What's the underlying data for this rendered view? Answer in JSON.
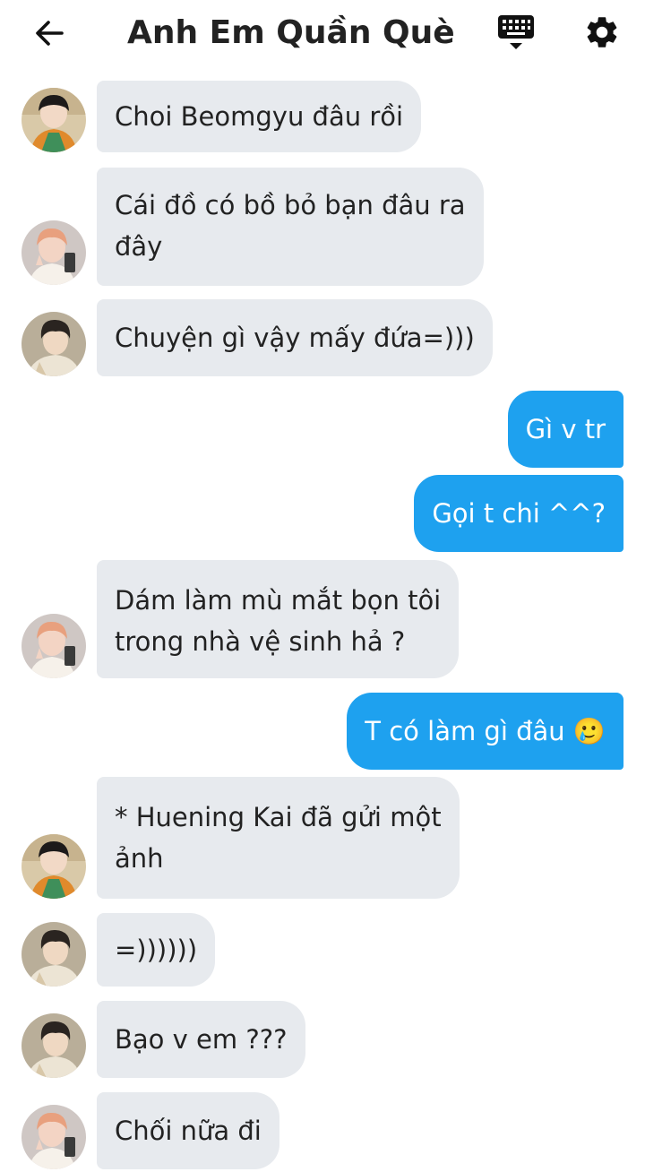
{
  "header": {
    "title": "Anh Em Quần Què",
    "back_icon": "arrow-left-icon",
    "keyboard_icon": "keyboard-icon",
    "settings_icon": "gear-icon"
  },
  "messages": [
    {
      "direction": "incoming",
      "avatar": "avatar-a",
      "text": "Choi Beomgyu đâu rồi"
    },
    {
      "direction": "incoming",
      "avatar": "avatar-b",
      "lines": [
        "Cái đồ có bồ bỏ bạn đâu ra",
        "đây"
      ]
    },
    {
      "direction": "incoming",
      "avatar": "avatar-c",
      "text": "Chuyện gì vậy mấy đứa=)))"
    },
    {
      "direction": "outgoing",
      "text": "Gì v tr"
    },
    {
      "direction": "outgoing",
      "text": "Gọi t chi ^^?"
    },
    {
      "direction": "incoming",
      "avatar": "avatar-b",
      "lines": [
        "Dám làm mù mắt bọn tôi",
        "trong nhà vệ sinh hả ?"
      ]
    },
    {
      "direction": "outgoing",
      "text": "T có làm gì đâu 🥲"
    },
    {
      "direction": "incoming",
      "avatar": "avatar-a",
      "lines": [
        "* Huening Kai đã gửi một",
        "ảnh"
      ]
    },
    {
      "direction": "incoming",
      "avatar": "avatar-c",
      "text": "=))))))"
    },
    {
      "direction": "incoming",
      "avatar": "avatar-c",
      "text": "Bạo v em ???"
    },
    {
      "direction": "incoming",
      "avatar": "avatar-b",
      "text": "Chối nữa đi"
    }
  ],
  "colors": {
    "incoming_bubble": "#e7eaee",
    "outgoing_bubble": "#1ea1ef",
    "header_text": "#222222"
  }
}
